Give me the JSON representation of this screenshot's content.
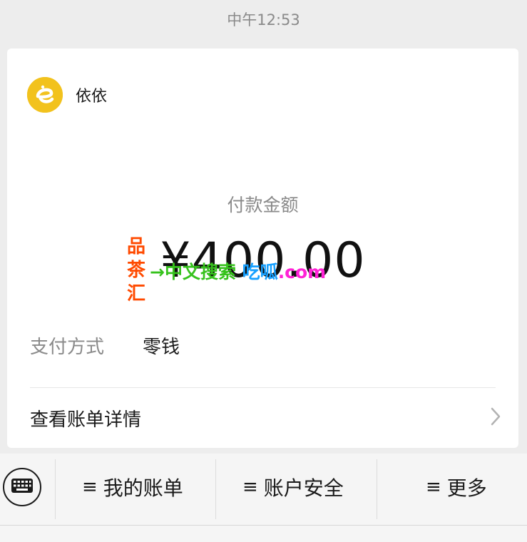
{
  "status_bar": {
    "time": "中午12:53"
  },
  "merchant": {
    "name": "依依"
  },
  "payment": {
    "amount_label": "付款金额",
    "amount": "¥400.00",
    "method_label": "支付方式",
    "method_value": "零钱",
    "detail_label": "查看账单详情"
  },
  "watermark": {
    "side": [
      "品",
      "茶",
      "汇"
    ],
    "segments": [
      {
        "text": "→中文搜索",
        "color": "#36c21c"
      },
      {
        "text": " ",
        "color": "#000000"
      },
      {
        "text": "吃呱",
        "color": "#17a0ff"
      },
      {
        "text": ".com",
        "color": "#ff22d6"
      }
    ],
    "side_color": "#ff4a00"
  },
  "bottom_menu": {
    "items": [
      {
        "label": "我的账单"
      },
      {
        "label": "账户安全"
      },
      {
        "label": "更多"
      }
    ]
  },
  "icons": {
    "merchant_logo": "merchant-logo-icon",
    "chevron": "chevron-right-icon",
    "keyboard": "keyboard-icon",
    "menu": "menu-lines-icon"
  }
}
